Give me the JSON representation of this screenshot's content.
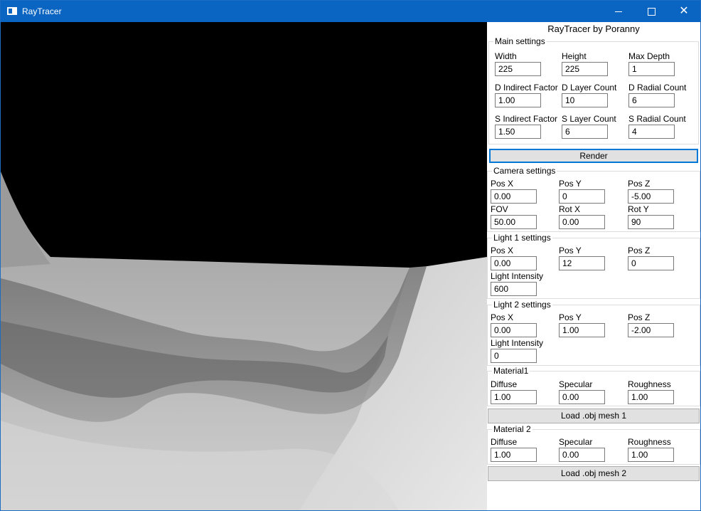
{
  "window": {
    "title": "RayTracer"
  },
  "panel": {
    "title": "RayTracer by Poranny",
    "main": {
      "legend": "Main settings",
      "fields": [
        {
          "label": "Width",
          "value": "225"
        },
        {
          "label": "Height",
          "value": "225"
        },
        {
          "label": "Max Depth",
          "value": "1"
        },
        {
          "label": "D Indirect Factor",
          "value": "1.00"
        },
        {
          "label": "D Layer Count",
          "value": "10"
        },
        {
          "label": "D Radial Count",
          "value": "6"
        },
        {
          "label": "S Indirect Factor",
          "value": "1.50"
        },
        {
          "label": "S Layer Count",
          "value": "6"
        },
        {
          "label": "S Radial Count",
          "value": "4"
        }
      ]
    },
    "render_label": "Render",
    "camera": {
      "legend": "Camera settings",
      "fields": [
        {
          "label": "Pos X",
          "value": "0.00"
        },
        {
          "label": "Pos Y",
          "value": "0"
        },
        {
          "label": "Pos Z",
          "value": "-5.00"
        },
        {
          "label": "FOV",
          "value": "50.00"
        },
        {
          "label": "Rot X",
          "value": "0.00"
        },
        {
          "label": "Rot Y",
          "value": "90"
        }
      ]
    },
    "light1": {
      "legend": "Light 1 settings",
      "fields": [
        {
          "label": "Pos X",
          "value": "0.00"
        },
        {
          "label": "Pos Y",
          "value": "12"
        },
        {
          "label": "Pos Z",
          "value": "0"
        },
        {
          "label": "Light Intensity",
          "value": "600"
        }
      ]
    },
    "light2": {
      "legend": "Light 2 settings",
      "fields": [
        {
          "label": "Pos X",
          "value": "0.00"
        },
        {
          "label": "Pos Y",
          "value": "1.00"
        },
        {
          "label": "Pos Z",
          "value": "-2.00"
        },
        {
          "label": "Light Intensity",
          "value": "0"
        }
      ]
    },
    "material1": {
      "legend": "Material1",
      "fields": [
        {
          "label": "Diffuse",
          "value": "1.00"
        },
        {
          "label": "Specular",
          "value": "0.00"
        },
        {
          "label": "Roughness",
          "value": "1.00"
        }
      ],
      "load_label": "Load .obj mesh 1"
    },
    "material2": {
      "legend": "Material 2",
      "fields": [
        {
          "label": "Diffuse",
          "value": "1.00"
        },
        {
          "label": "Specular",
          "value": "0.00"
        },
        {
          "label": "Roughness",
          "value": "1.00"
        }
      ],
      "load_label": "Load .obj mesh 2"
    }
  },
  "colors": {
    "titlebar": "#0a64c2",
    "focus": "#0078d7"
  }
}
